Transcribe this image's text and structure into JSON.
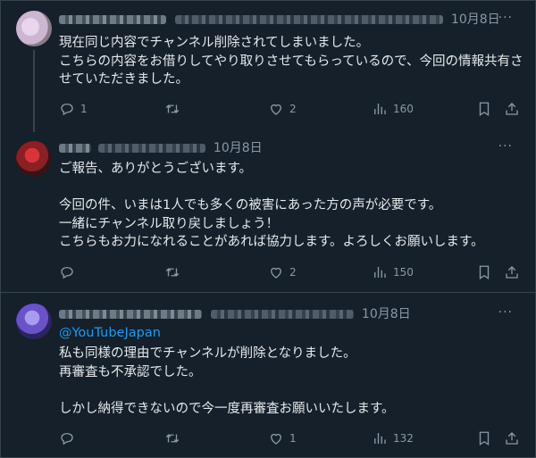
{
  "tweets": [
    {
      "time": "10月8日",
      "body": "現在同じ内容でチャンネル削除されてしまいました。\nこちらの内容をお借りしてやり取りさせてもらっているので、今回の情報共有させていただきました。",
      "reply_count": "1",
      "retweet_count": "",
      "like_count": "2",
      "view_count": "160"
    },
    {
      "time": "10月8日",
      "body": "ご報告、ありがとうございます。\n\n今回の件、いまは1人でも多くの被害にあった方の声が必要です。\n一緒にチャンネル取り戻しましょう！\nこちらもお力になれることがあれば協力します。よろしくお願いします。",
      "reply_count": "",
      "retweet_count": "",
      "like_count": "2",
      "view_count": "150"
    },
    {
      "time": "10月8日",
      "mention": "@YouTubeJapan",
      "body": "私も同様の理由でチャンネルが削除となりました。\n再審査も不承認でした。\n\nしかし納得できないので今一度再審査お願いいたします。",
      "reply_count": "",
      "retweet_count": "",
      "like_count": "1",
      "view_count": "132"
    }
  ],
  "more_label": "···",
  "icons": [
    "reply-icon",
    "retweet-icon",
    "like-icon",
    "views-icon",
    "bookmark-icon",
    "share-icon"
  ],
  "colors": {
    "background": "#15202b",
    "text": "#e7e9ea",
    "muted": "#8b98a5",
    "link": "#1d9bf0",
    "border": "#38444d"
  }
}
